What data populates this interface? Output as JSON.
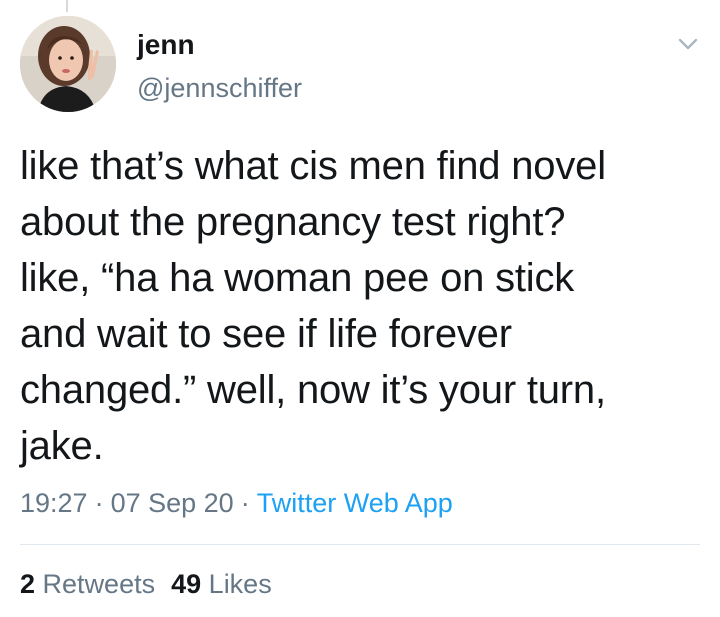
{
  "user": {
    "display_name": "jenn",
    "handle": "@jennschiffer"
  },
  "tweet": {
    "text": "like that’s what cis men find novel\nabout the pregnancy test right?\nlike, “ha ha woman pee on stick\nand wait to see if life forever\nchanged.” well, now it’s your turn,\njake.",
    "time": "19:27",
    "date": "07 Sep 20",
    "source": "Twitter Web App",
    "separator": "·"
  },
  "stats": {
    "retweets_count": "2",
    "retweets_label": "Retweets",
    "likes_count": "49",
    "likes_label": "Likes"
  },
  "icons": {
    "menu": "chevron-down-icon",
    "avatar": "profile-photo"
  },
  "colors": {
    "text": "#14171a",
    "secondary": "#657786",
    "link": "#1da1f2",
    "divider": "#e1e8ed"
  }
}
